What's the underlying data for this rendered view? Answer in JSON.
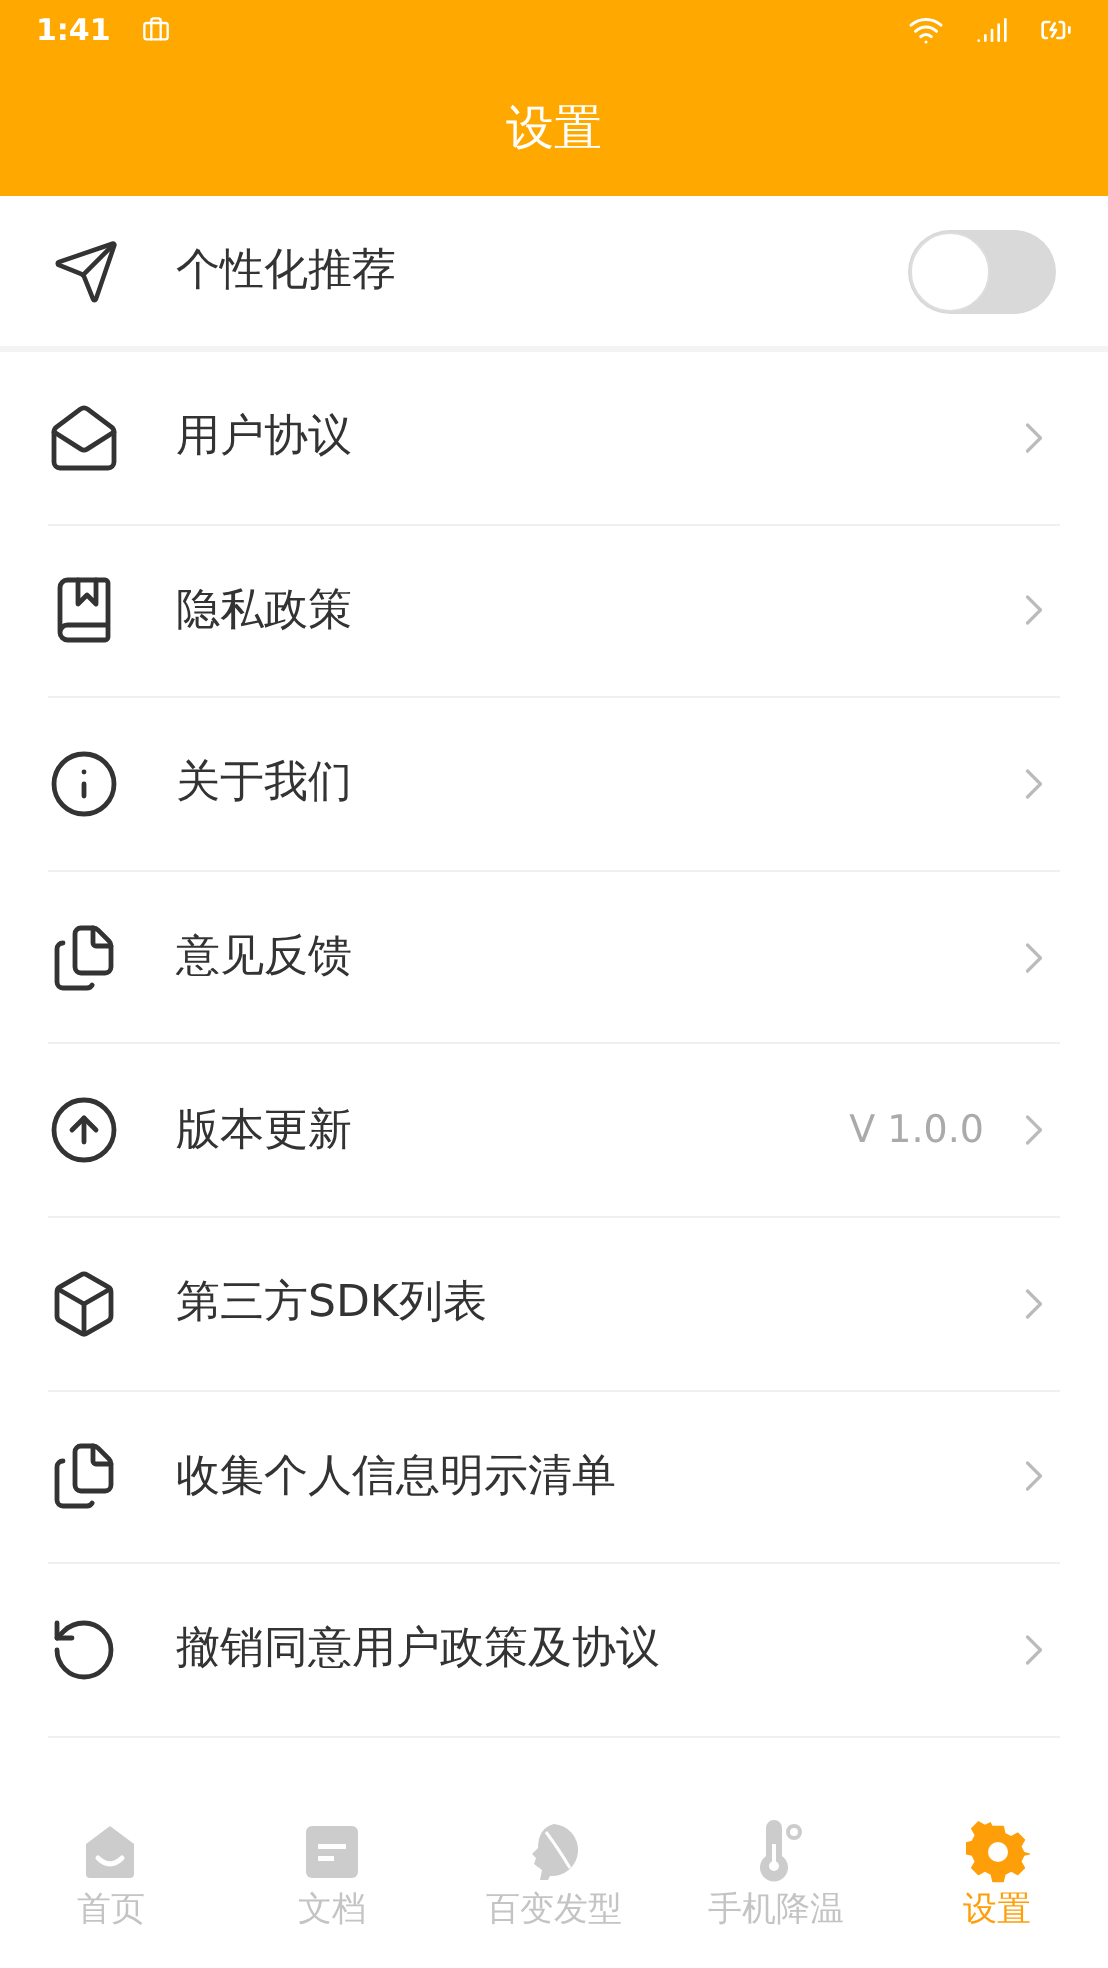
{
  "status_bar": {
    "time": "1:41"
  },
  "header": {
    "title": "设置"
  },
  "personalize": {
    "label": "个性化推荐",
    "on": false
  },
  "items": [
    {
      "label": "用户协议"
    },
    {
      "label": "隐私政策"
    },
    {
      "label": "关于我们"
    },
    {
      "label": "意见反馈"
    },
    {
      "label": "版本更新",
      "value": "V 1.0.0"
    },
    {
      "label": "第三方SDK列表"
    },
    {
      "label": "收集个人信息明示清单"
    },
    {
      "label": "撤销同意用户政策及协议"
    }
  ],
  "nav": [
    {
      "label": "首页",
      "selected": false
    },
    {
      "label": "文档",
      "selected": false
    },
    {
      "label": "百变发型",
      "selected": false
    },
    {
      "label": "手机降温",
      "selected": false
    },
    {
      "label": "设置",
      "selected": true
    }
  ]
}
